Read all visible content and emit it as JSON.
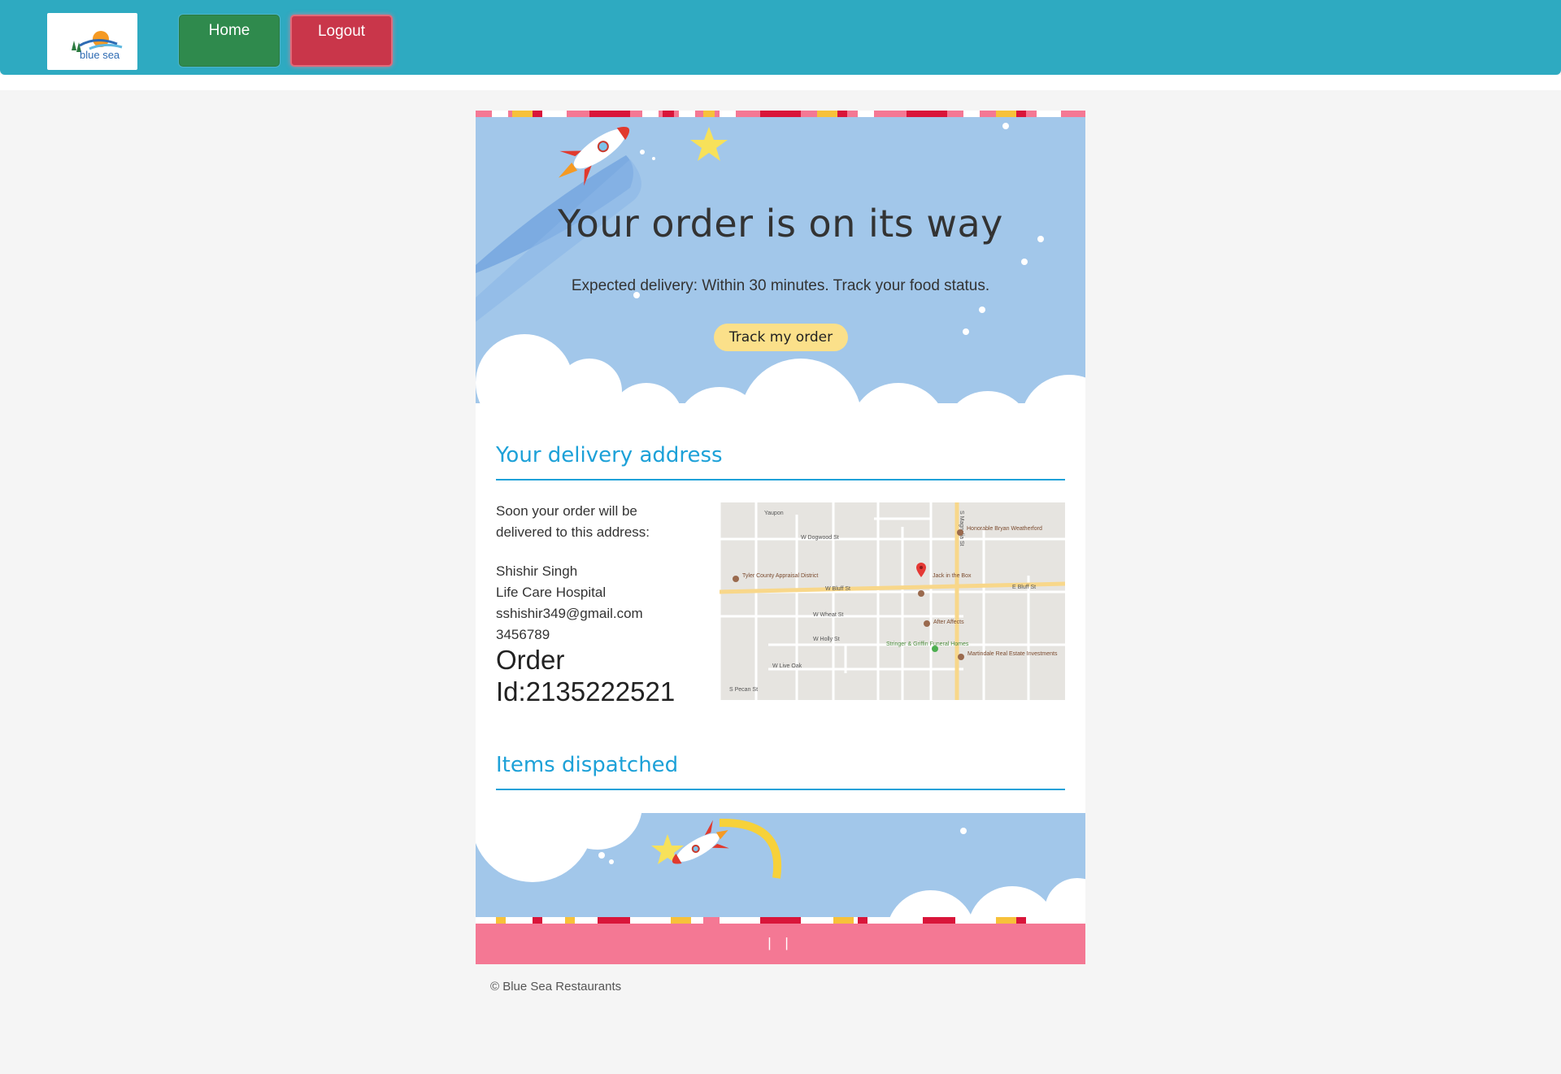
{
  "nav": {
    "logo_text": "blue sea",
    "home_label": "Home",
    "logout_label": "Logout",
    "colors": {
      "bar": "#2eaac1",
      "home": "#2f8a4d",
      "logout": "#c9364a"
    }
  },
  "hero": {
    "title": "Your order is on its way",
    "subtitle": "Expected delivery: Within 30 minutes. Track your food status.",
    "track_button": "Track my order",
    "background": "#a2c7ea",
    "icons": [
      "rocket-icon",
      "star-icon",
      "cloud-icon"
    ]
  },
  "delivery": {
    "heading": "Your delivery address",
    "intro": "Soon your order will be delivered to this address:",
    "name": "Shishir Singh",
    "place": "Life Care Hospital",
    "email": "sshishir349@gmail.com",
    "phone": "3456789",
    "order_id": "Order Id:2135222521",
    "map": {
      "streets": [
        "Yaupon",
        "W Dogwood St",
        "W Bluff St",
        "E Bluff St",
        "W Wheat St",
        "W Holly St",
        "W Live Oak",
        "S Pecan St",
        "S Magnolia St"
      ],
      "places": [
        "Honorable Bryan Weatherford",
        "Tyler County Appraisal District",
        "Jack in the Box",
        "After Affects",
        "Stringer & Griffin Funeral Homes",
        "Martindale Real Estate Investments"
      ]
    }
  },
  "items": {
    "heading": "Items dispatched"
  },
  "footer": {
    "links": "| |",
    "copyright": "© Blue Sea Restaurants",
    "color": "#f47894"
  }
}
